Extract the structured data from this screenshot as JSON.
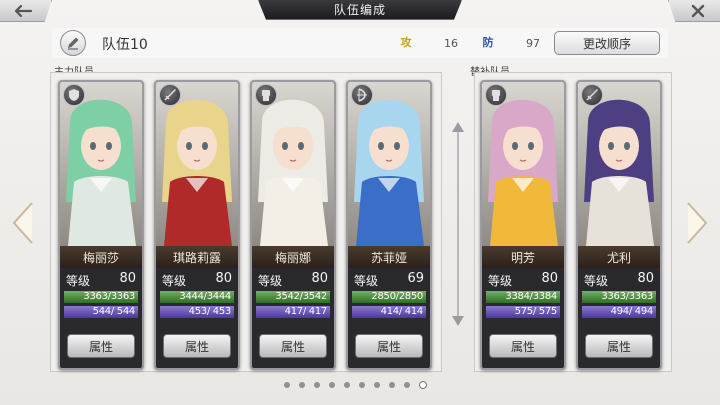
{
  "header": {
    "title": "队伍编成"
  },
  "team": {
    "name": "队伍10",
    "attack_icon": "attack-icon",
    "attack_value": "16",
    "defense_icon": "defense-icon",
    "defense_value": "97",
    "reorder_label": "更改顺序"
  },
  "sections": {
    "main_label": "主力队员",
    "sub_label": "替补队员"
  },
  "cards": [
    {
      "name": "梅丽莎",
      "level_label": "等级",
      "level": "80",
      "hp": "3363/3363",
      "sp": "544/ 544",
      "attr_label": "属性",
      "weapon_icon": "shield-icon",
      "hair": "#7ecfa5",
      "accent": "#dfe8e2"
    },
    {
      "name": "琪路莉露",
      "level_label": "等级",
      "level": "80",
      "hp": "3444/3444",
      "sp": "453/ 453",
      "attr_label": "属性",
      "weapon_icon": "sword-icon",
      "hair": "#e9d48c",
      "accent": "#b02a2a"
    },
    {
      "name": "梅丽娜",
      "level_label": "等级",
      "level": "80",
      "hp": "3542/3542",
      "sp": "417/ 417",
      "attr_label": "属性",
      "weapon_icon": "gauntlet-icon",
      "hair": "#ecebe6",
      "accent": "#f3efe6"
    },
    {
      "name": "苏菲娅",
      "level_label": "等级",
      "level": "69",
      "hp": "2850/2850",
      "sp": "414/ 414",
      "attr_label": "属性",
      "weapon_icon": "bow-icon",
      "hair": "#a9d6ef",
      "accent": "#3a6ec9"
    },
    {
      "name": "明芳",
      "level_label": "等级",
      "level": "80",
      "hp": "3384/3384",
      "sp": "575/ 575",
      "attr_label": "属性",
      "weapon_icon": "gauntlet-icon",
      "hair": "#d9a7c8",
      "accent": "#f0b93a"
    },
    {
      "name": "尤利",
      "level_label": "等级",
      "level": "80",
      "hp": "3363/3363",
      "sp": "494/ 494",
      "attr_label": "属性",
      "weapon_icon": "sword-icon",
      "hair": "#4e3f83",
      "accent": "#e6e1d9"
    }
  ],
  "pagination": {
    "count": 10,
    "active_index": 9
  }
}
